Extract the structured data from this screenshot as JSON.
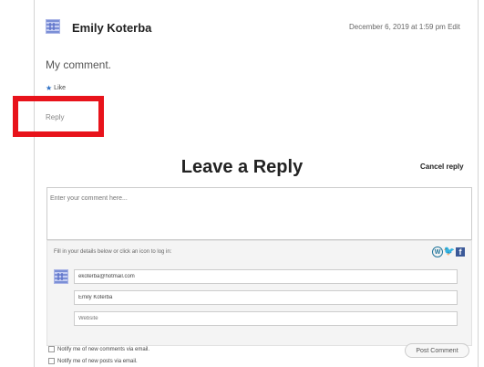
{
  "comment": {
    "author": "Emily Koterba",
    "date": "December 6, 2019 at 1:59 pm Edit",
    "text": "My comment.",
    "like_label": "Like",
    "reply_label": "Reply"
  },
  "reply_form": {
    "title": "Leave a Reply",
    "cancel_label": "Cancel reply",
    "comment_placeholder": "Enter your comment here...",
    "login_hint": "Fill in your details below or click an icon to log in:",
    "email_value": "ekoterba@hotmail.com",
    "name_value": "Emily Koterba",
    "website_value": "Website",
    "notify_comments_label": "Notify me of new comments via email.",
    "notify_posts_label": "Notify me of new posts via email.",
    "post_button_label": "Post Comment"
  },
  "icons": {
    "wordpress": "wordpress-icon",
    "twitter": "twitter-icon",
    "facebook": "facebook-icon"
  },
  "colors": {
    "highlight": "#e8131b",
    "like_star": "#2a6ec4",
    "facebook": "#3b5998",
    "twitter": "#1da1f2",
    "wordpress": "#21759b"
  }
}
